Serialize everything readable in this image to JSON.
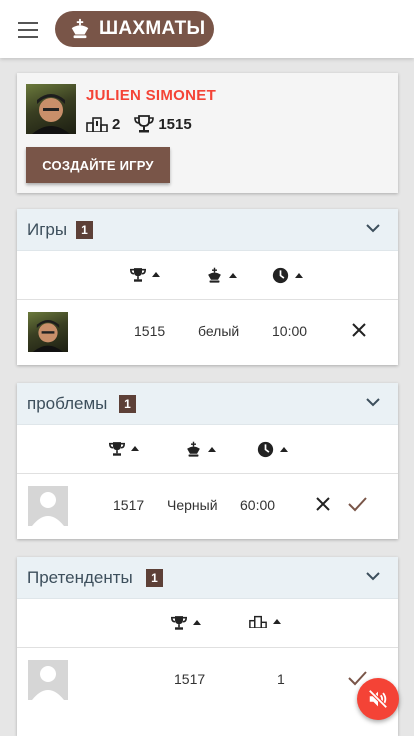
{
  "app": {
    "title": "ШАХМАТЫ",
    "icon": "chess-king-icon"
  },
  "profile": {
    "name": "JULIEN SIMONET",
    "wins": "2",
    "rating": "1515",
    "create_label": "СОЗДАЙТЕ ИГРУ"
  },
  "sections": [
    {
      "title": "Игры",
      "count": "1",
      "sort_columns": [
        "rating",
        "color",
        "time"
      ],
      "rows": [
        {
          "rating": "1515",
          "color": "белый",
          "time": "10:00",
          "actions": [
            "decline"
          ]
        }
      ]
    },
    {
      "title": "проблемы",
      "count": "1",
      "sort_columns": [
        "rating",
        "color",
        "time"
      ],
      "rows": [
        {
          "rating": "1517",
          "color": "Черный",
          "time": "60:00",
          "actions": [
            "decline",
            "accept"
          ]
        }
      ]
    },
    {
      "title": "Претенденты",
      "count": "1",
      "sort_columns": [
        "rating",
        "wins"
      ],
      "rows": [
        {
          "rating": "1517",
          "wins": "1",
          "actions": [
            "accept"
          ]
        }
      ]
    }
  ],
  "fab": {
    "icon": "volume-off-icon"
  },
  "colors": {
    "brand": "#795548",
    "badge": "#5d4037",
    "accent": "#f44336",
    "section_header": "#eaf1f5",
    "background": "#e6e6e6"
  }
}
